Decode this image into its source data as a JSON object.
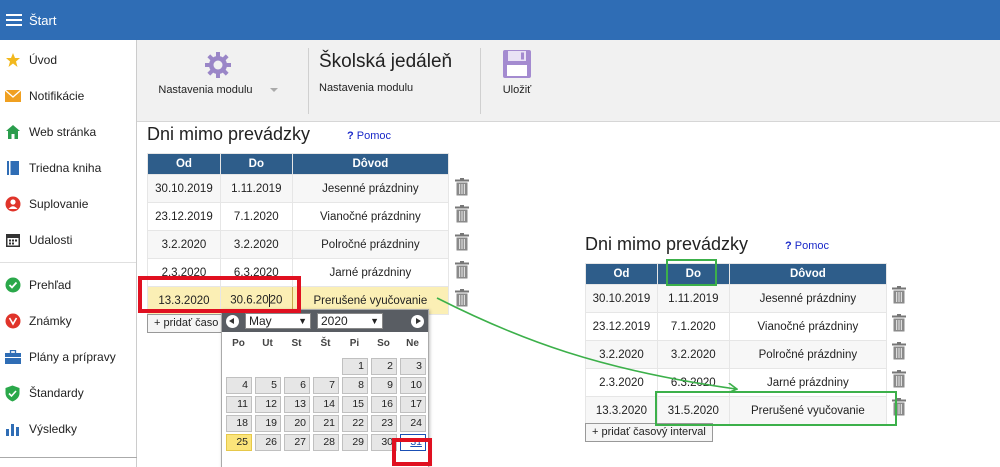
{
  "topbar": {
    "title": "Štart"
  },
  "sidebar": {
    "items": [
      {
        "label": "Úvod",
        "icon": "star-icon",
        "color": "#f2b81d"
      },
      {
        "label": "Notifikácie",
        "icon": "envelope-icon",
        "color": "#f0a020"
      },
      {
        "label": "Web stránka",
        "icon": "home-icon",
        "color": "#2a9d4c"
      },
      {
        "label": "Triedna kniha",
        "icon": "book-icon",
        "color": "#2f6db5"
      },
      {
        "label": "Suplovanie",
        "icon": "person-icon",
        "color": "#e0342a"
      },
      {
        "label": "Udalosti",
        "icon": "calendar-icon",
        "color": "#333333"
      },
      {
        "label": "Prehľad",
        "icon": "check-circle-icon",
        "color": "#2aa84a"
      },
      {
        "label": "Známky",
        "icon": "grade-icon",
        "color": "#e0342a"
      },
      {
        "label": "Plány a prípravy",
        "icon": "briefcase-icon",
        "color": "#2f6db5"
      },
      {
        "label": "Štandardy",
        "icon": "shield-icon",
        "color": "#2aa84a"
      },
      {
        "label": "Výsledky",
        "icon": "bar-chart-icon",
        "color": "#2f6db5"
      }
    ]
  },
  "toolbar": {
    "settings_label": "Nastavenia modulu",
    "module_title": "Školská jedáleň",
    "module_subtitle": "Nastavenia modulu",
    "save_label": "Uložiť"
  },
  "left_panel": {
    "title": "Dni mimo prevádzky",
    "help_label": "Pomoc",
    "headers": {
      "from": "Od",
      "to": "Do",
      "reason": "Dôvod"
    },
    "rows": [
      {
        "from": "30.10.2019",
        "to": "1.11.2019",
        "reason": "Jesenné prázdniny"
      },
      {
        "from": "23.12.2019",
        "to": "7.1.2020",
        "reason": "Vianočné prázdniny"
      },
      {
        "from": "3.2.2020",
        "to": "3.2.2020",
        "reason": "Polročné prázdniny"
      },
      {
        "from": "2.3.2020",
        "to": "6.3.2020",
        "reason": "Jarné prázdniny"
      },
      {
        "from": "13.3.2020",
        "to_a": "30.6.20",
        "to_b": "20",
        "reason": "Prerušené vyučovanie"
      }
    ],
    "add_label": "+ pridať časo"
  },
  "calendar": {
    "month": "May",
    "year": "2020",
    "days_of_week": [
      "Po",
      "Ut",
      "St",
      "Št",
      "Pi",
      "So",
      "Ne"
    ],
    "days": [
      "",
      "",
      "",
      "",
      "1",
      "2",
      "3",
      "4",
      "5",
      "6",
      "7",
      "8",
      "9",
      "10",
      "11",
      "12",
      "13",
      "14",
      "15",
      "16",
      "17",
      "18",
      "19",
      "20",
      "21",
      "22",
      "23",
      "24",
      "25",
      "26",
      "27",
      "28",
      "29",
      "30",
      "31"
    ],
    "today": "25",
    "selected": "31"
  },
  "right_panel": {
    "title": "Dni mimo prevádzky",
    "help_label": "Pomoc",
    "headers": {
      "from": "Od",
      "to": "Do",
      "reason": "Dôvod"
    },
    "rows": [
      {
        "from": "30.10.2019",
        "to": "1.11.2019",
        "reason": "Jesenné prázdniny"
      },
      {
        "from": "23.12.2019",
        "to": "7.1.2020",
        "reason": "Vianočné prázdniny"
      },
      {
        "from": "3.2.2020",
        "to": "3.2.2020",
        "reason": "Polročné prázdniny"
      },
      {
        "from": "2.3.2020",
        "to": "6.3.2020",
        "reason": "Jarné prázdniny"
      },
      {
        "from": "13.3.2020",
        "to": "31.5.2020",
        "reason": "Prerušené vyučovanie"
      }
    ],
    "add_label": "+ pridať časový interval"
  },
  "colors": {
    "topbar": "#2f6db5",
    "table_header": "#2e5d8a",
    "highlight_row": "#fbefb5",
    "annotation_red": "#e01020",
    "annotation_green": "#3cb04a",
    "help_link": "#1a29c9"
  }
}
